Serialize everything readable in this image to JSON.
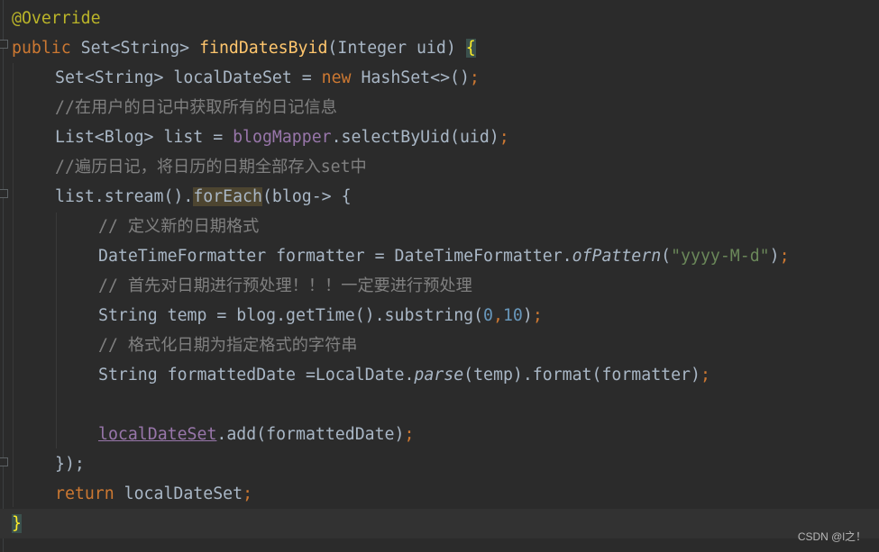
{
  "code": {
    "l1": {
      "annotation": "@Override"
    },
    "l2": {
      "kw_public": "public",
      "t1": " Set<String> ",
      "method": "findDatesByid",
      "t2": "(Integer uid) ",
      "brace": "{"
    },
    "l3": {
      "t1": "Set<String> localDateSet = ",
      "kw_new": "new",
      "t2": " HashSet<>()",
      "semi": ";"
    },
    "l4": {
      "comment": "//在用户的日记中获取所有的日记信息"
    },
    "l5": {
      "t1": "List<Blog> list = ",
      "field": "blogMapper",
      "t2": ".selectByUid(uid)",
      "semi": ";"
    },
    "l6": {
      "comment": "//遍历日记，将日历的日期全部存入set中"
    },
    "l7": {
      "t1": "list.stream().",
      "foreach": "forEach",
      "t2": "(blog-> {"
    },
    "l8": {
      "comment": "// 定义新的日期格式"
    },
    "l9": {
      "t1": "DateTimeFormatter formatter = DateTimeFormatter.",
      "method": "ofPattern",
      "t2": "(",
      "str": "\"yyyy-M-d\"",
      "t3": ")",
      "semi": ";"
    },
    "l10": {
      "comment": "// 首先对日期进行预处理！！！一定要进行预处理"
    },
    "l11": {
      "t1": "String temp = blog.getTime().substring(",
      "n1": "0",
      "comma": ",",
      "n2": "10",
      "t2": ")",
      "semi": ";"
    },
    "l12": {
      "comment": "// 格式化日期为指定格式的字符串"
    },
    "l13": {
      "t1": "String formattedDate =LocalDate.",
      "method": "parse",
      "t2": "(temp).format(formatter)",
      "semi": ";"
    },
    "l15": {
      "field": "localDateSet",
      "t1": ".add(formattedDate)",
      "semi": ";"
    },
    "l16": {
      "t1": "});"
    },
    "l17": {
      "kw_return": "return",
      "t1": " localDateSet",
      "semi": ";"
    },
    "l18": {
      "brace": "}"
    }
  },
  "watermark": "CSDN @l之！",
  "colors": {
    "background": "#2b2b2b",
    "keyword": "#cc7832",
    "annotation": "#bbb529",
    "method_decl": "#ffc66d",
    "field": "#9876aa",
    "number": "#6897bb",
    "string": "#6a8759",
    "comment": "#808080",
    "text": "#a9b7c6"
  }
}
